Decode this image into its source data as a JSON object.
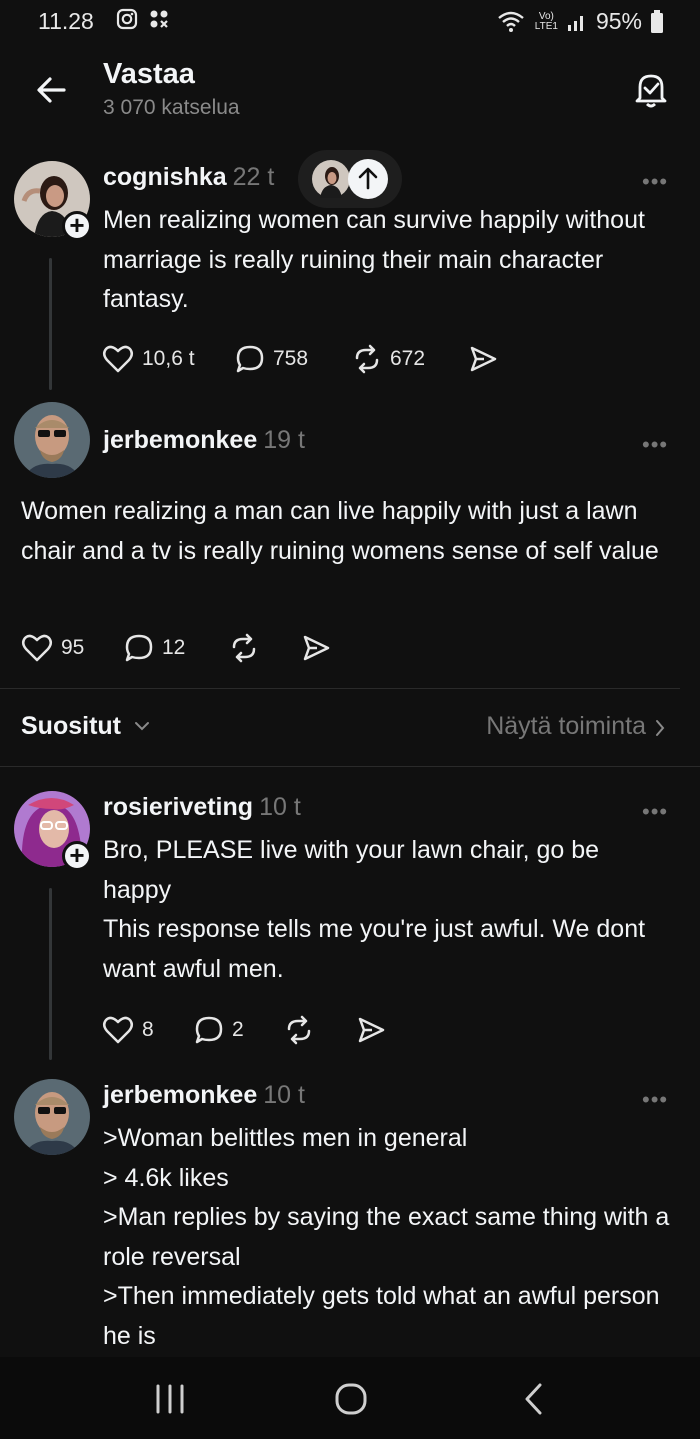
{
  "status_bar": {
    "time": "11.28",
    "battery": "95%",
    "network_top": "Vo)",
    "network_bottom": "LTE1"
  },
  "header": {
    "title": "Vastaa",
    "subtitle": "3 070 katselua"
  },
  "posts": [
    {
      "username": "cognishka",
      "time": "22 t",
      "text": "Men realizing women can survive happily without marriage is really ruining their main character fantasy.",
      "likes": "10,6 t",
      "replies": "758",
      "reposts": "672"
    },
    {
      "username": "jerbemonkee",
      "time": "19 t",
      "text": "Women realizing a man can live happily with just a lawn chair and a tv is really ruining womens sense of self value",
      "likes": "95",
      "replies": "12"
    },
    {
      "username": "rosieriveting",
      "time": "10 t",
      "line1": "Bro, PLEASE live with your lawn chair, go be happy",
      "line2": "This response tells me you're just awful. We dont want awful men.",
      "likes": "8",
      "replies": "2"
    },
    {
      "username": "jerbemonkee",
      "time": "10 t",
      "lines": [
        ">Woman belittles men in general",
        "> 4.6k likes",
        ">Man replies by saying the exact same thing with a role reversal",
        ">Then immediately gets told what an awful person he is"
      ]
    }
  ],
  "sort": {
    "label": "Suositut",
    "activity_link": "Näytä toiminta"
  },
  "colors": {
    "background": "#101010",
    "text": "#f3f5f7",
    "muted": "#777777",
    "divider": "#2a2a2a"
  },
  "icons": [
    "back-arrow-icon",
    "bell-check-icon",
    "heart-icon",
    "comment-icon",
    "repost-icon",
    "share-icon",
    "more-icon",
    "chevron-down-icon",
    "chevron-right-icon",
    "plus-icon",
    "arrow-up-icon"
  ]
}
